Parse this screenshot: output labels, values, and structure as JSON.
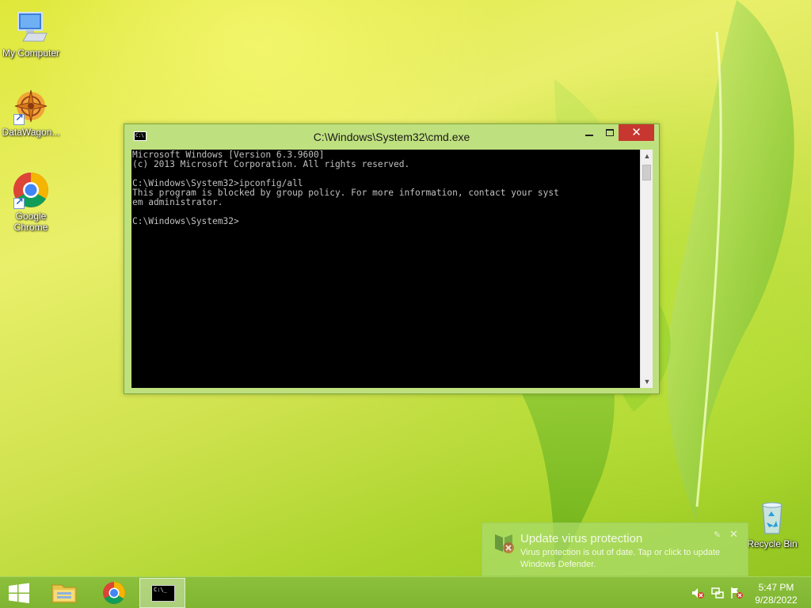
{
  "desktop": {
    "icons": [
      {
        "label": "My Computer"
      },
      {
        "label": "DataWagon..."
      },
      {
        "label": "Google Chrome"
      },
      {
        "label": "Recycle Bin"
      }
    ]
  },
  "cmd_window": {
    "title": "C:\\Windows\\System32\\cmd.exe",
    "icon_text": "C:\\",
    "console_lines": [
      "Microsoft Windows [Version 6.3.9600]",
      "(c) 2013 Microsoft Corporation. All rights reserved.",
      "",
      "C:\\Windows\\System32>ipconfig/all",
      "This program is blocked by group policy. For more information, contact your syst",
      "em administrator.",
      "",
      "C:\\Windows\\System32>"
    ]
  },
  "toast": {
    "title": "Update virus protection",
    "body": "Virus protection is out of date. Tap or click to update Windows Defender."
  },
  "taskbar": {
    "cmd_icon_text": "C:\\_",
    "clock_time": "5:47 PM",
    "clock_date": "9/28/2022"
  },
  "colors": {
    "close_button": "#c7372f",
    "taskbar": "#7fb532",
    "console_bg": "#000000",
    "console_text": "#c0c0c0"
  }
}
